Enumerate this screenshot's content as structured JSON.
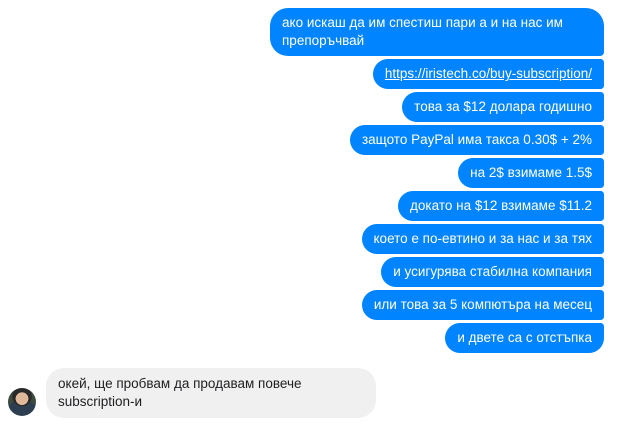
{
  "conversation": {
    "outgoing": [
      "ако искаш да им спестиш пари а и на нас им препоръчвай",
      "https://iristech.co/buy-subscription/",
      "това за $12 долара годишно",
      "защото PayPal има такса 0.30$ + 2%",
      "на 2$ взимаме 1.5$",
      "докато на $12 взимаме $11.2",
      "което е по-евтино и за нас и за тях",
      "и усигурява стабилна компания",
      "или това за 5 компютъра на месец",
      "и двете са с отстъпка"
    ],
    "incoming": [
      "окей, ще пробвам да продавам повече subscription-и"
    ]
  },
  "colors": {
    "outgoing_bubble": "#0084ff",
    "incoming_bubble": "#f1f0f0"
  }
}
